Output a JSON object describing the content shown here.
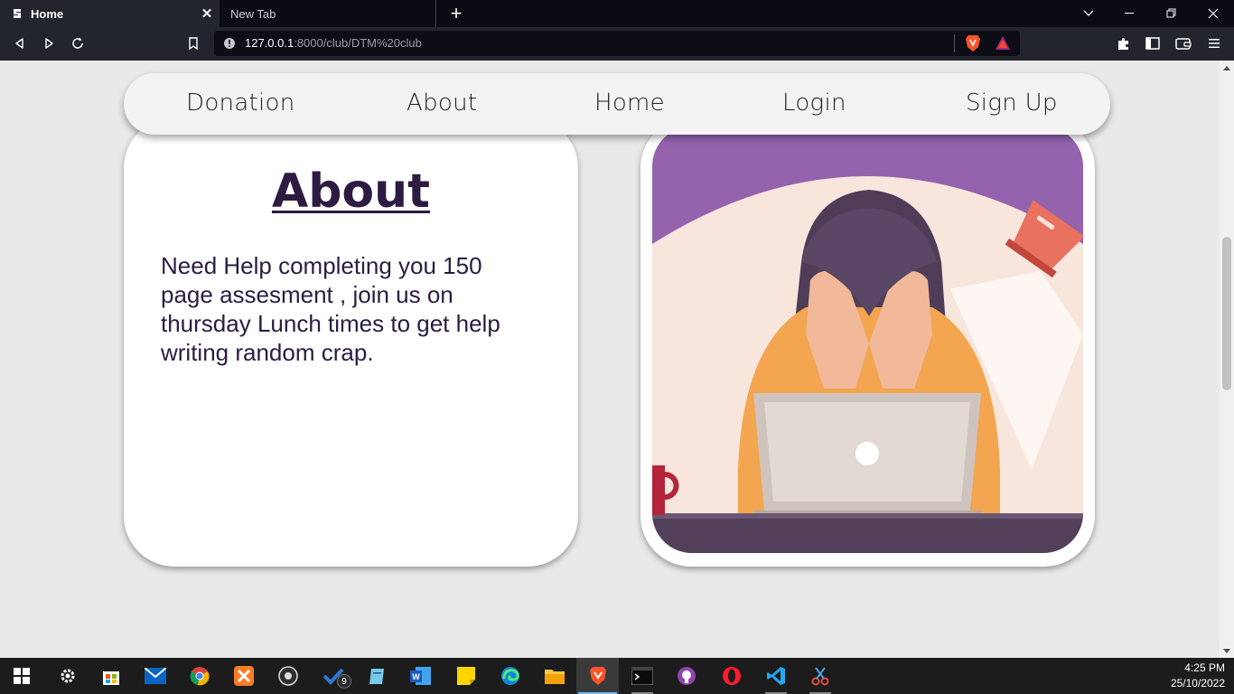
{
  "browser": {
    "tabs": [
      {
        "title": "Home",
        "active": true
      },
      {
        "title": "New Tab",
        "active": false
      }
    ],
    "new_tab_symbol": "+",
    "url": {
      "host": "127.0.0.1",
      "path": ":8000/club/DTM%20club"
    },
    "icons": [
      "back-icon",
      "forward-icon",
      "reload-icon",
      "bookmark-icon",
      "info-icon",
      "brave-shield-icon",
      "brave-rewards-icon",
      "extensions-icon",
      "sidebar-icon",
      "wallet-icon",
      "menu-icon"
    ]
  },
  "page": {
    "nav": {
      "items": [
        "Donation",
        "About",
        "Home",
        "Login",
        "Sign Up"
      ]
    },
    "about": {
      "title": "About",
      "body": "Need Help completing you 150 page assesment , join us on thursday Lunch times to get help writing random crap."
    },
    "illustration": "woman-stressed-at-laptop-illustration"
  },
  "taskbar": {
    "apps": [
      "start",
      "settings",
      "microsoft-store",
      "mail",
      "chrome",
      "xampp",
      "obs",
      "todo",
      "notepad",
      "word",
      "sticky-notes",
      "edge",
      "file-explorer",
      "brave",
      "terminal",
      "github-desktop",
      "opera",
      "vscode",
      "snipping-tool"
    ],
    "todo_badge": "9",
    "time": "4:25 PM",
    "date": "25/10/2022"
  },
  "colors": {
    "title_color": "#2d1b41",
    "page_bg": "#e9e9e9",
    "nav_bg": "#f3f3f3"
  }
}
